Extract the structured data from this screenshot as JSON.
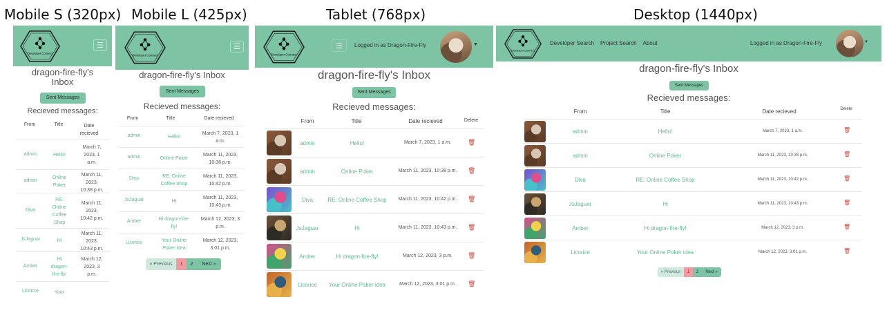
{
  "viewports": {
    "mobile_s": "Mobile S (320px)",
    "mobile_l": "Mobile L (425px)",
    "tablet": "Tablet (768px)",
    "desktop": "Desktop (1440px)"
  },
  "brand": {
    "logo_text": "Developer Connect"
  },
  "nav": {
    "links": [
      "Developer Search",
      "Project Search",
      "About"
    ],
    "logged_in": "Logged in as Dragon-Fire-Fly",
    "dropdown_icon": "caret-down-icon",
    "menu_icon": "hamburger-icon"
  },
  "inbox": {
    "title": "dragon-fire-fly's Inbox",
    "title_line1": "dragon-fire-fly's",
    "title_line2": "Inbox",
    "sent_button": "Sent Messages",
    "received_heading": "Recieved messages:",
    "columns": {
      "from": "From",
      "title": "Title",
      "date": "Date recieved",
      "delete": "Delete"
    },
    "mobile_date_header": [
      "Date",
      "recieved"
    ]
  },
  "messages": [
    {
      "from": "admin",
      "title": "Hello!",
      "date": "March 7, 2023, 1 a.m.",
      "mobile_s_title": [
        "Hello!"
      ],
      "mobile_s_date": [
        "March 7,",
        "2023, 1",
        "a.m."
      ],
      "mobile_l_title": [
        "Hello!"
      ],
      "mobile_l_date": [
        "March 7, 2023, 1",
        "a.m."
      ]
    },
    {
      "from": "admin",
      "title": "Online Poker",
      "date": "March 11, 2023, 10:38 p.m.",
      "mobile_s_title": [
        "Online",
        "Poker"
      ],
      "mobile_s_date": [
        "March 11,",
        "2023,",
        "10:38 p.m."
      ],
      "mobile_l_title": [
        "Online Poker"
      ],
      "mobile_l_date": [
        "March 11, 2023,",
        "10:38 p.m."
      ]
    },
    {
      "from": "Diva",
      "title": "RE: Online Coffee Shop",
      "date": "March 11, 2023, 10:42 p.m.",
      "mobile_s_title": [
        "RE:",
        "Online",
        "Coffee",
        "Shop"
      ],
      "mobile_s_date": [
        "March 11,",
        "2023,",
        "10:42 p.m."
      ],
      "mobile_l_title": [
        "RE: Online",
        "Coffee Shop"
      ],
      "mobile_l_date": [
        "March 11, 2023,",
        "10:42 p.m."
      ]
    },
    {
      "from": "JsJaguar",
      "title": "Hi",
      "date": "March 11, 2023, 10:43 p.m.",
      "mobile_s_title": [
        "Hi"
      ],
      "mobile_s_date": [
        "March 11,",
        "2023,",
        "10:43 p.m."
      ],
      "mobile_l_title": [
        "Hi"
      ],
      "mobile_l_date": [
        "March 11, 2023,",
        "10:43 p.m."
      ]
    },
    {
      "from": "Amber",
      "title": "Hi dragon-fire-fly!",
      "date": "March 12, 2023, 3 p.m.",
      "mobile_s_title": [
        "Hi",
        "dragon-",
        "fire-fly!"
      ],
      "mobile_s_date": [
        "March 12,",
        "2023, 3",
        "p.m."
      ],
      "mobile_l_title": [
        "Hi dragon-fire-",
        "fly!"
      ],
      "mobile_l_date": [
        "March 12, 2023, 3",
        "p.m."
      ]
    },
    {
      "from": "Licorice",
      "title": "Your Online Poker idea",
      "date": "March 12, 2023, 3:01 p.m.",
      "mobile_s_title": [
        "Your"
      ],
      "mobile_s_date": [],
      "mobile_l_title": [
        "Your Online",
        "Poker idea"
      ],
      "mobile_l_date": [
        "March 12, 2023,",
        "3:01 p.m."
      ]
    }
  ],
  "avatars": [
    {
      "sender": "admin",
      "colors": [
        "#8a5a3a",
        "#d8c7b4",
        "#5b3a26"
      ]
    },
    {
      "sender": "admin",
      "colors": [
        "#8a5a3a",
        "#d8c7b4",
        "#5b3a26"
      ]
    },
    {
      "sender": "Diva",
      "colors": [
        "#7a4fd0",
        "#e14d8b",
        "#46c1c9"
      ]
    },
    {
      "sender": "JsJaguar",
      "colors": [
        "#6b5238",
        "#c9a56f",
        "#2e2a24"
      ]
    },
    {
      "sender": "Amber",
      "colors": [
        "#d94f8c",
        "#f2d24a",
        "#3fa56b"
      ]
    },
    {
      "sender": "Licorice",
      "colors": [
        "#c2662b",
        "#2f5c7a",
        "#e8b04a"
      ]
    }
  ],
  "profile_avatar_colors": [
    "#caa27e",
    "#6b4f3a",
    "#e9dccb"
  ],
  "pagination": {
    "prev": "« Previous",
    "page1": "1",
    "page2": "2",
    "next": "Next »"
  },
  "colors": {
    "brand_green": "#7cc4a4",
    "link_green": "#5fb98f",
    "delete_red": "#c9493d",
    "page_active": "#f19aa2"
  }
}
